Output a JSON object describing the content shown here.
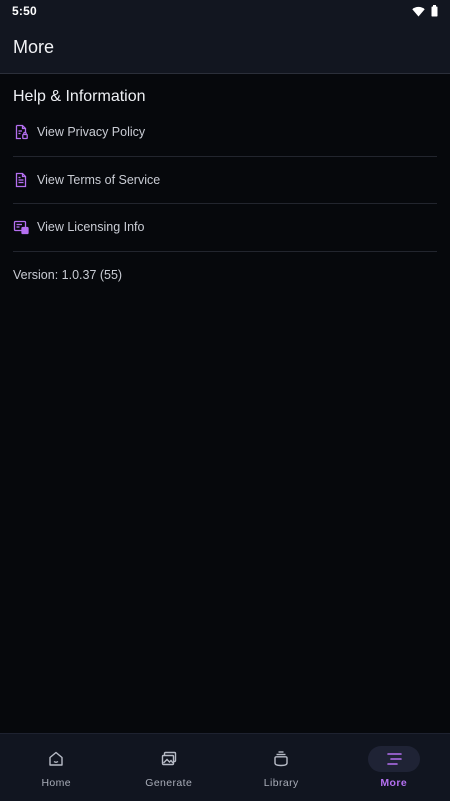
{
  "status_bar": {
    "time": "5:50"
  },
  "app_bar": {
    "title": "More"
  },
  "section": {
    "heading": "Help & Information"
  },
  "menu_items": [
    {
      "label": "View Privacy Policy",
      "icon": "privacy-document-icon"
    },
    {
      "label": "View Terms of Service",
      "icon": "terms-document-icon"
    },
    {
      "label": "View Licensing Info",
      "icon": "licensing-icon"
    }
  ],
  "version_text": "Version: 1.0.37 (55)",
  "bottom_nav": {
    "items": [
      {
        "label": "Home",
        "icon": "home-icon",
        "active": false
      },
      {
        "label": "Generate",
        "icon": "generate-icon",
        "active": false
      },
      {
        "label": "Library",
        "icon": "library-icon",
        "active": false
      },
      {
        "label": "More",
        "icon": "menu-icon",
        "active": true
      }
    ]
  },
  "colors": {
    "accent": "#b46ff0",
    "background": "#06080c",
    "bar": "#121620"
  }
}
